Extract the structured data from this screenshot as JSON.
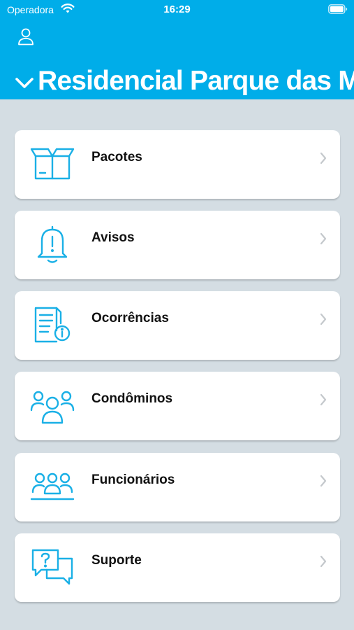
{
  "status_bar": {
    "carrier": "Operadora",
    "time": "16:29"
  },
  "header": {
    "title": "Residencial Parque das Mangueiras",
    "background_color": "#00ade9",
    "profile_icon": "person-icon",
    "dropdown_icon": "chevron-down-icon"
  },
  "menu": {
    "items": [
      {
        "label": "Pacotes",
        "icon": "package-box-icon"
      },
      {
        "label": "Avisos",
        "icon": "bell-alert-icon"
      },
      {
        "label": "Ocorrências",
        "icon": "document-info-icon"
      },
      {
        "label": "Condôminos",
        "icon": "residents-group-icon"
      },
      {
        "label": "Funcionários",
        "icon": "staff-group-icon"
      },
      {
        "label": "Suporte",
        "icon": "help-chat-icon"
      }
    ],
    "accent_color": "#1ab0e6"
  }
}
